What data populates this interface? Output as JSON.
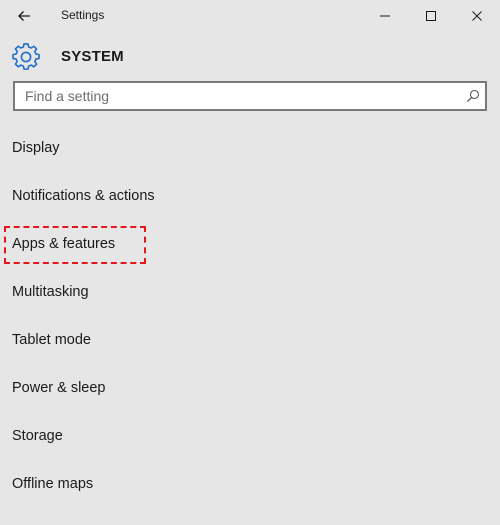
{
  "window": {
    "title": "Settings"
  },
  "header": {
    "title": "SYSTEM",
    "icon": "gear-icon",
    "accent_color": "#1e6fc9"
  },
  "search": {
    "placeholder": "Find a setting",
    "value": ""
  },
  "nav": {
    "items": [
      {
        "label": "Display"
      },
      {
        "label": "Notifications & actions"
      },
      {
        "label": "Apps & features",
        "highlighted": true
      },
      {
        "label": "Multitasking"
      },
      {
        "label": "Tablet mode"
      },
      {
        "label": "Power & sleep"
      },
      {
        "label": "Storage"
      },
      {
        "label": "Offline maps"
      }
    ],
    "highlight_color": "#e4161b"
  }
}
